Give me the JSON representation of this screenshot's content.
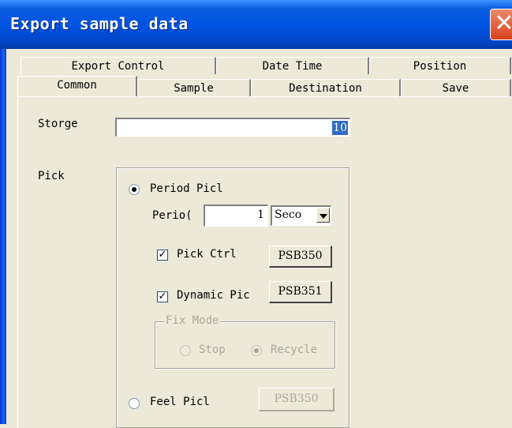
{
  "window": {
    "title": "Export sample data",
    "close_glyph": "✕"
  },
  "tabs": {
    "back_row": [
      "Export Control",
      "Date Time",
      "Position"
    ],
    "front_row": [
      "Common",
      "Sample",
      "Destination",
      "Save"
    ],
    "active": "Common"
  },
  "storage": {
    "label": "Storge",
    "value": "10"
  },
  "pick": {
    "label": "Pick",
    "period_pick": {
      "label": "Period Picl",
      "checked": true
    },
    "period": {
      "label": "Perio(",
      "value": "1",
      "unit": "Seco"
    },
    "pick_ctrl": {
      "label": "Pick Ctrl",
      "checked": true,
      "button": "PSB350"
    },
    "dynamic_pick": {
      "label": "Dynamic Pic",
      "checked": true,
      "button": "PSB351"
    },
    "fix_mode": {
      "label": "Fix Mode",
      "stop": "Stop",
      "recycle": "Recycle",
      "selected": "Recycle"
    },
    "feel_pick": {
      "label": "Feel Picl",
      "checked": false,
      "button": "PSB350"
    }
  }
}
